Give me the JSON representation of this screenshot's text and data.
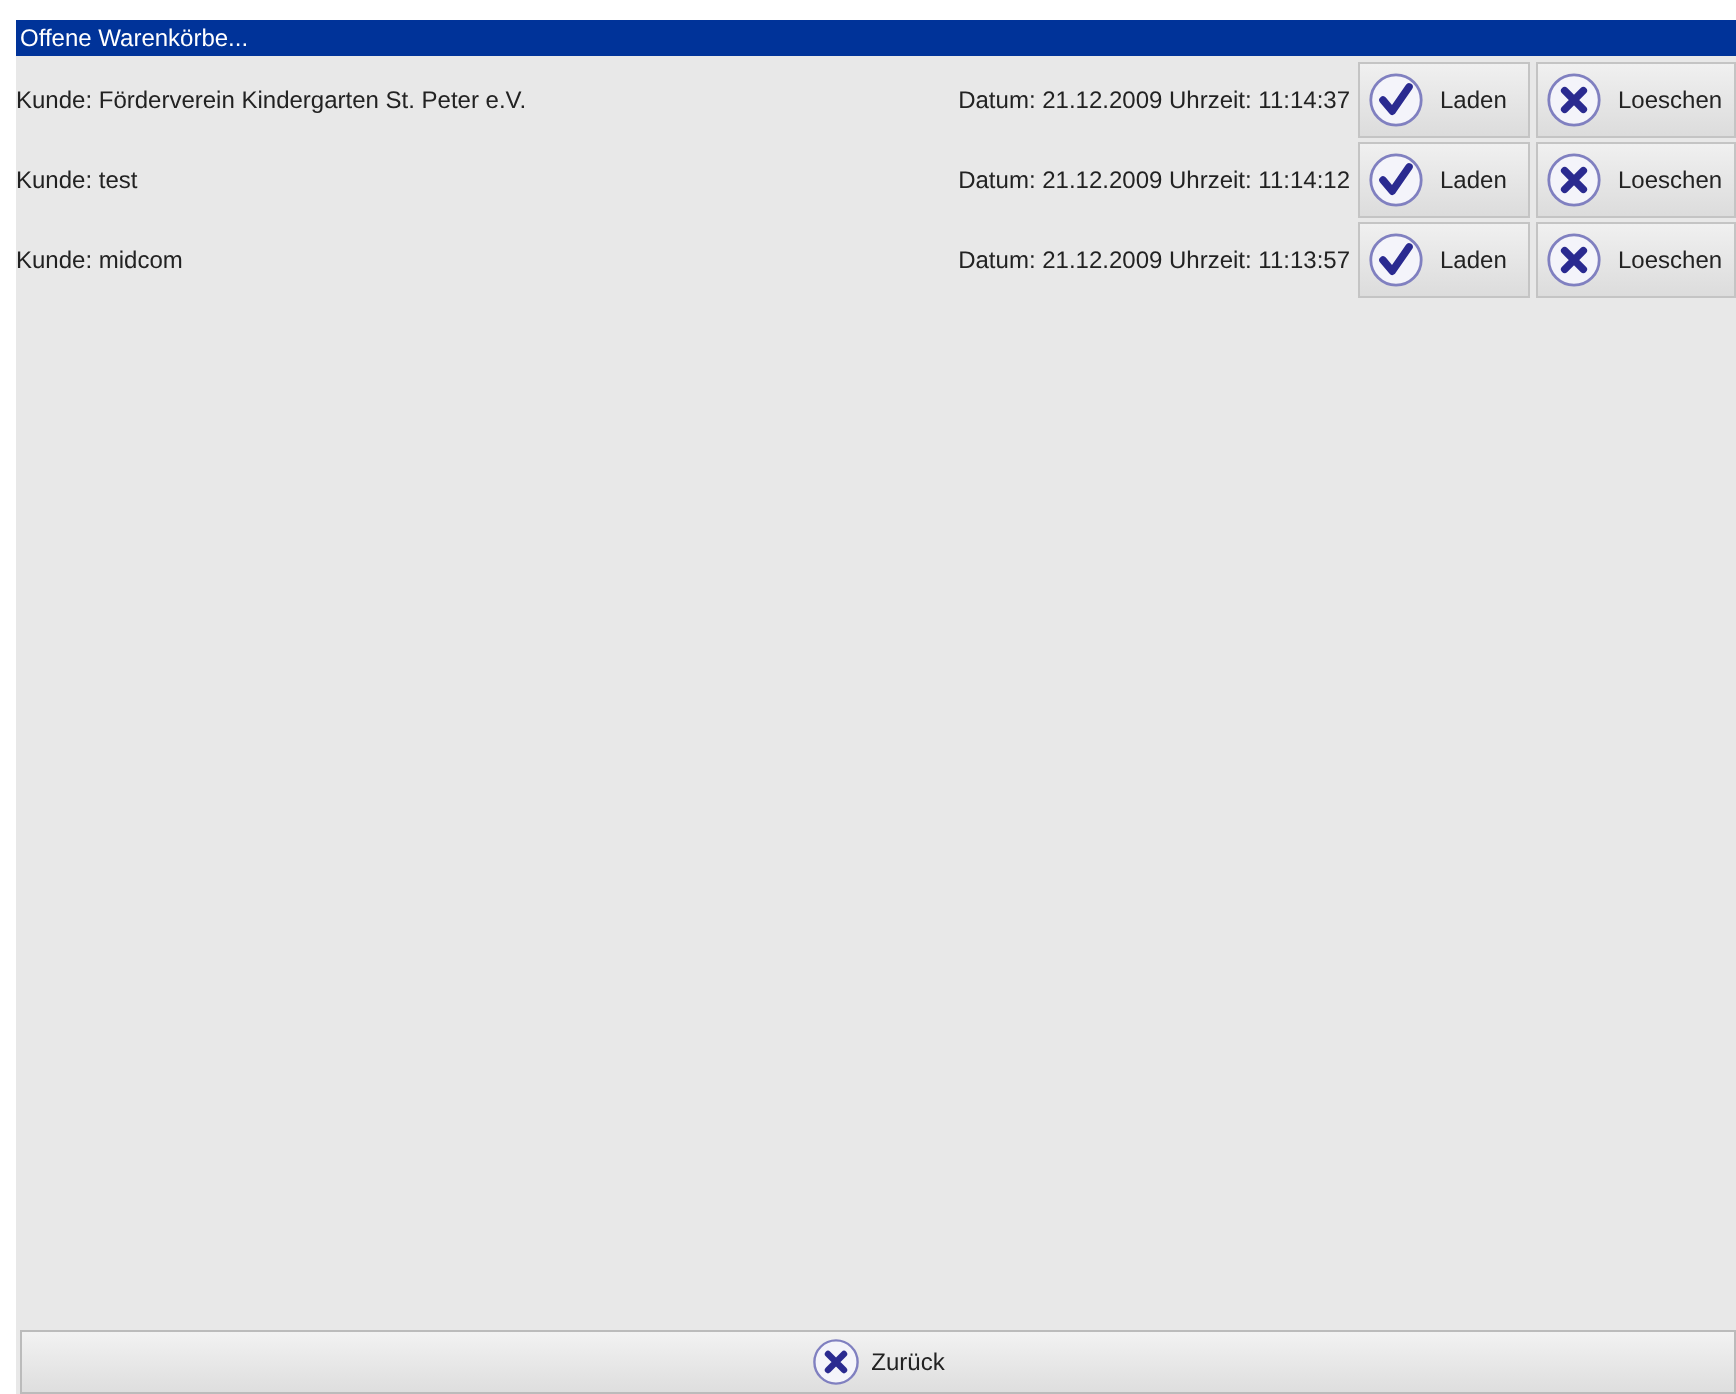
{
  "window": {
    "title": "Offene Warenkörbe..."
  },
  "carts": [
    {
      "customer": "Kunde: Förderverein Kindergarten St. Peter e.V.",
      "timestamp": "Datum: 21.12.2009 Uhrzeit: 11:14:37",
      "load": "Laden",
      "delete": "Loeschen"
    },
    {
      "customer": "Kunde: test",
      "timestamp": "Datum: 21.12.2009 Uhrzeit: 11:14:12",
      "load": "Laden",
      "delete": "Loeschen"
    },
    {
      "customer": "Kunde: midcom",
      "timestamp": "Datum: 21.12.2009 Uhrzeit: 11:13:57",
      "load": "Laden",
      "delete": "Loeschen"
    }
  ],
  "back_button": "Zurück"
}
